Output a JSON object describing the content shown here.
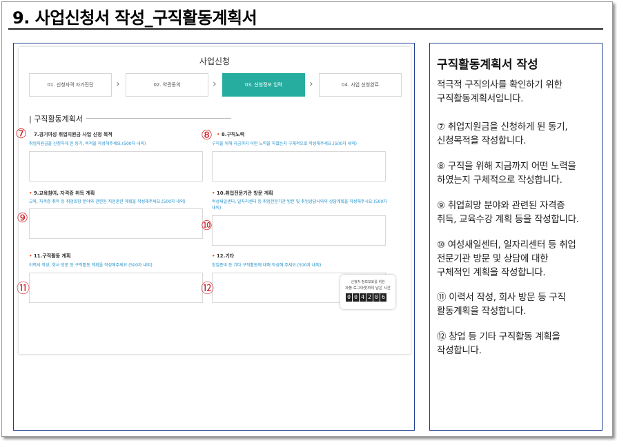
{
  "header": {
    "title": "9. 사업신청서 작성_구직활동계획서"
  },
  "screen": {
    "title": "사업신청",
    "steps": [
      {
        "label": "01. 신청자격 자가진단"
      },
      {
        "label": "02. 약관동의"
      },
      {
        "label": "03. 신청정보 입력"
      },
      {
        "label": "04. 사업 신청완료"
      }
    ],
    "active_step_color": "#27ada0",
    "section": "| 구직활동계획서",
    "fields": {
      "f7": {
        "label": "7.경기여성 취업지원금 사업 신청 목적",
        "hint": "취업지원금을 신청하게 된 동기, 목적을 작성해주세요.(500자 내외)",
        "marker": "⑦"
      },
      "f8": {
        "label": "8.구직노력",
        "hint": "구직을 위해 지금까지 어떤 노력을 하였는지 구체적으로 작성해주세요.(500자 내외)",
        "marker": "⑧"
      },
      "f9": {
        "label": "9.교육참여, 자격증 취득 계획",
        "hint": "교육, 자격증 취득 등 취업희망 분야와 관련된 직업훈련 계획을 작성해주세요.(500자 내외)",
        "marker": "⑨"
      },
      "f10": {
        "label": "10.취업전문기관 방문 계획",
        "hint": "여성새일센터, 일자리센터 등 취업전문기관 방문 및 취업상담사와의 상담계획을 작성해주시요.(500자 내외)",
        "marker": "⑩"
      },
      "f11": {
        "label": "11.구직활동 계획",
        "hint": "이력서 작성, 회사 방문 등 구직활동 계획을 작성해주세요.(500자 내외)",
        "marker": "⑪"
      },
      "f12": {
        "label": "12.기타",
        "hint": "창업준비 등 기타 구직활동에 대해 작성해 주세요.(500자 내외)",
        "marker": "⑫"
      }
    },
    "timer": {
      "line1": "신청자 정보보호를 위한",
      "line2": "자동 로그아웃까지 남은 시간",
      "digits": [
        "0",
        "0",
        "4",
        "2",
        "0",
        "6"
      ]
    }
  },
  "guide": {
    "title": "구직활동계획서 작성",
    "paragraphs": [
      "적극적 구직의사를 확인하기 위한\n구직활동계획서입니다.",
      "⑦ 취업지원금을 신청하게 된 동기,\n 신청목적을 작성합니다.",
      "⑧ 구직을 위해 지금까지 어떤 노력을\n하였는지 구체적으로 작성합니다.",
      "⑨ 취업희망 분야와 관련된 자격증\n 취득, 교육수강 계획 등을 작성합니다.",
      "⑩ 여성새일센터, 일자리센터 등 취업\n전문기관 방문 및 상담에 대한\n구체적인 계획을 작성합니다.",
      "⑪ 이력서 작성, 회사 방문 등 구직\n활동계획을 작성합니다.",
      "⑫ 창업 등 기타 구직활동 계획을\n 작성합니다."
    ]
  },
  "colors": {
    "accent_red": "#d2232a",
    "hint_blue": "#1d8fc9",
    "panel_border": "#1f3f8f"
  }
}
